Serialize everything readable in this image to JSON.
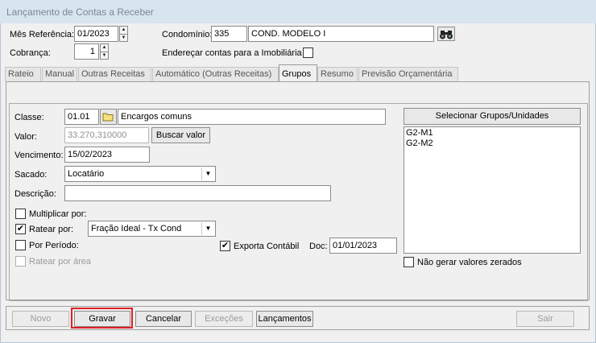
{
  "window": {
    "title": "Lançamento de Contas a Receber"
  },
  "header": {
    "mes_referencia_label": "Mês Referência:",
    "mes_referencia_value": "01/2023",
    "cobranca_label": "Cobrança:",
    "cobranca_value": "1",
    "condominio_label": "Condomínio:",
    "condominio_code": "335",
    "condominio_name": "COND. MODELO I",
    "enderecar_label": "Endereçar contas para a Imobiliária",
    "enderecar_checked": false
  },
  "tabs": [
    "Rateio",
    "Manual",
    "Outras Receitas",
    "Automático (Outras Receitas)",
    "Grupos",
    "Resumo",
    "Previsão Orçamentária"
  ],
  "active_tab": "Grupos",
  "form": {
    "classe_label": "Classe:",
    "classe_code": "01.01",
    "classe_name": "Encargos comuns",
    "valor_label": "Valor:",
    "valor_value": "33.270,310000",
    "buscar_valor": "Buscar valor",
    "vencimento_label": "Vencimento:",
    "vencimento_value": "15/02/2023",
    "sacado_label": "Sacado:",
    "sacado_value": "Locatário",
    "descricao_label": "Descrição:",
    "descricao_value": "",
    "multiplicar_label": "Multiplicar por:",
    "ratear_label": "Ratear por:",
    "ratear_value": "Fração Ideal - Tx Cond",
    "por_periodo_label": "Por Período:",
    "exporta_label": "Exporta Contábil",
    "doc_label": "Doc:",
    "doc_value": "01/01/2023",
    "ratear_area_label": "Ratear por área"
  },
  "groups": {
    "select_button": "Selecionar Grupos/Unidades",
    "items": [
      "G2-M1",
      "G2-M2"
    ],
    "nao_gerar_label": "Não gerar valores zerados"
  },
  "buttons": {
    "novo": "Novo",
    "gravar": "Gravar",
    "cancelar": "Cancelar",
    "excecoes": "Exceções",
    "lancamentos": "Lançamentos",
    "sair": "Sair"
  },
  "colors": {
    "highlight": "#e01f26",
    "titlebar": "#d9e4f1"
  }
}
